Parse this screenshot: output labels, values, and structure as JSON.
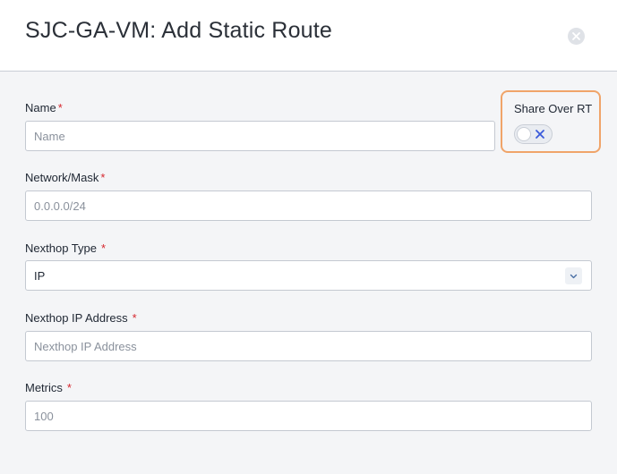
{
  "dialog": {
    "title": "SJC-GA-VM: Add Static Route",
    "close_icon": "close-icon"
  },
  "form": {
    "name": {
      "label": "Name",
      "required_marker": "*",
      "value": "",
      "placeholder": "Name"
    },
    "share_over_rt": {
      "label": "Share Over RT",
      "enabled": false,
      "off_icon": "x-icon",
      "highlight_color": "#f0a469"
    },
    "network_mask": {
      "label": "Network/Mask",
      "required_marker": "*",
      "value": "",
      "placeholder": "0.0.0.0/24"
    },
    "nexthop_type": {
      "label": "Nexthop Type",
      "required_marker": "*",
      "selected": "IP",
      "caret_icon": "chevron-down-icon"
    },
    "nexthop_ip": {
      "label": "Nexthop IP Address",
      "required_marker": "*",
      "value": "",
      "placeholder": "Nexthop IP Address"
    },
    "metrics": {
      "label": "Metrics",
      "required_marker": "*",
      "value": "",
      "placeholder": "100"
    }
  },
  "colors": {
    "required": "#d6272e",
    "accent_outline": "#f0a469",
    "toggle_x": "#3b5bdb"
  }
}
